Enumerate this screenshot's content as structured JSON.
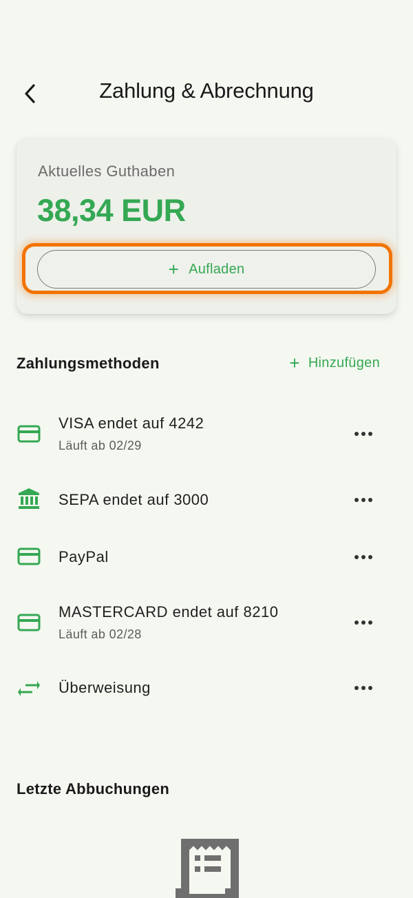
{
  "header": {
    "title": "Zahlung & Abrechnung"
  },
  "balance": {
    "label": "Aktuelles Guthaben",
    "amount": "38,34 EUR",
    "topup_icon": "+",
    "topup_label": "Aufladen"
  },
  "payment_methods": {
    "title": "Zahlungsmethoden",
    "add_icon": "+",
    "add_label": "Hinzufügen",
    "items": [
      {
        "icon": "card-icon",
        "label": "VISA endet auf 4242",
        "sub": "Läuft ab 02/29"
      },
      {
        "icon": "bank-icon",
        "label": "SEPA endet auf 3000"
      },
      {
        "icon": "card-icon",
        "label": "PayPal"
      },
      {
        "icon": "card-icon",
        "label": "MASTERCARD endet auf 8210",
        "sub": "Läuft ab 02/28"
      },
      {
        "icon": "transfer-icon",
        "label": "Überweisung"
      }
    ]
  },
  "recent": {
    "title": "Letzte Abbuchungen"
  },
  "colors": {
    "accent": "#34a853",
    "highlight": "#f27400",
    "background": "#f5f8f1"
  }
}
